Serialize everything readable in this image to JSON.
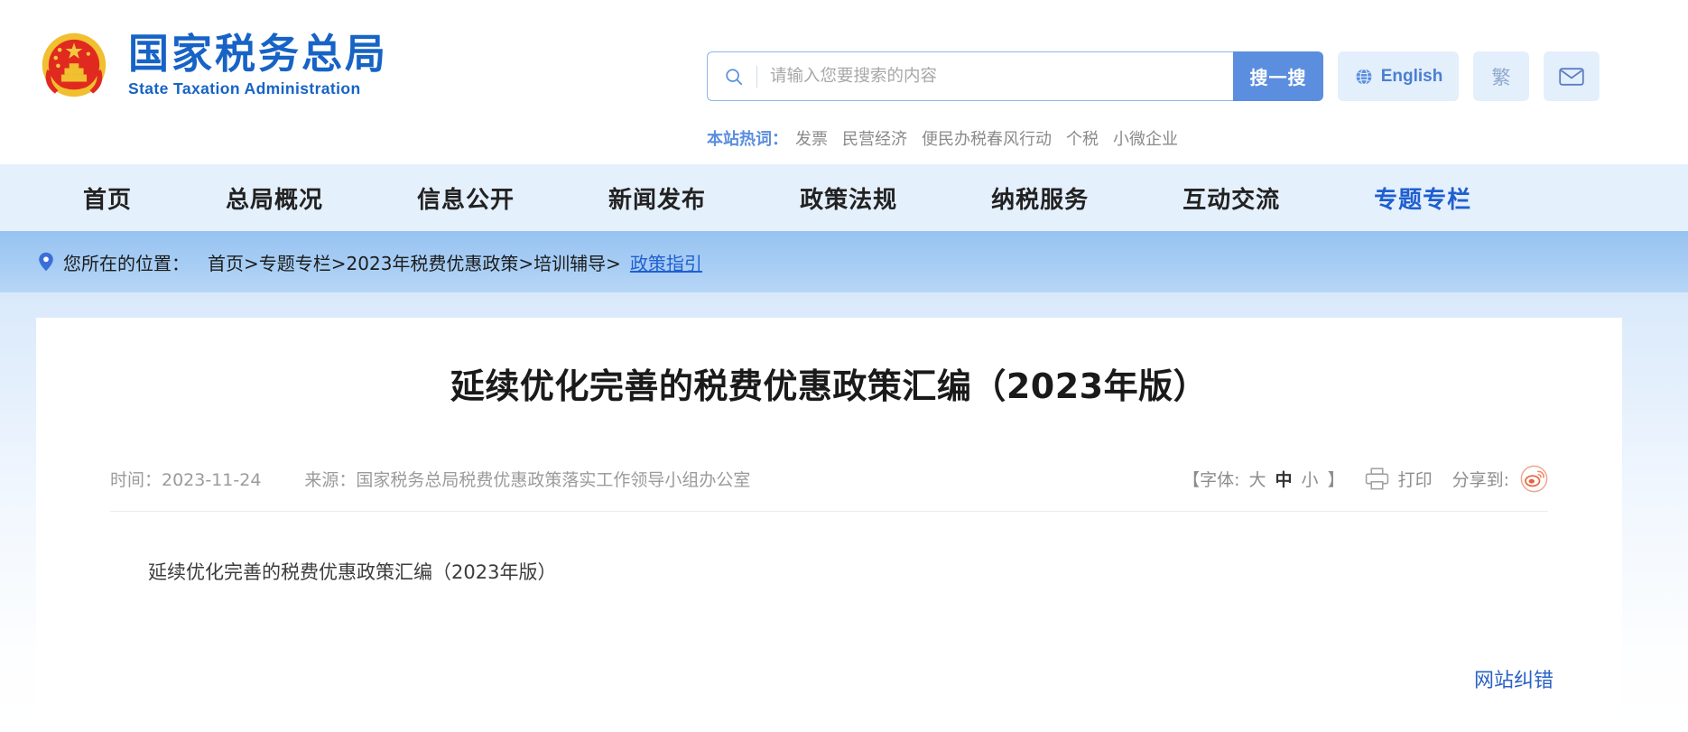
{
  "site": {
    "logo_cn": "国家税务总局",
    "logo_en": "State Taxation Administration",
    "emblem_icon": "national-emblem-icon"
  },
  "search": {
    "icon": "search-icon",
    "placeholder": "请输入您要搜索的内容",
    "value": "",
    "button_label": "搜一搜",
    "button_color": "#5b8ede"
  },
  "header_actions": {
    "english_label": "English",
    "english_icon": "globe-icon",
    "traditional_label": "繁",
    "mail_icon": "mail-icon"
  },
  "hotwords": {
    "label": "本站热词：",
    "items": [
      "发票",
      "民营经济",
      "便民办税春风行动",
      "个税",
      "小微企业"
    ]
  },
  "nav": {
    "items": [
      {
        "label": "首页",
        "active": false
      },
      {
        "label": "总局概况",
        "active": false
      },
      {
        "label": "信息公开",
        "active": false
      },
      {
        "label": "新闻发布",
        "active": false
      },
      {
        "label": "政策法规",
        "active": false
      },
      {
        "label": "纳税服务",
        "active": false
      },
      {
        "label": "互动交流",
        "active": false
      },
      {
        "label": "专题专栏",
        "active": true
      }
    ],
    "active_color": "#1f5fd0"
  },
  "breadcrumb": {
    "pin_icon": "location-pin-icon",
    "label": "您所在的位置：",
    "path_prefix": "首页>专题专栏>2023年税费优惠政策>培训辅导>",
    "current": "政策指引"
  },
  "article": {
    "title": "延续优化完善的税费优惠政策汇编（2023年版）",
    "time_label": "时间：2023-11-24",
    "source_label": "来源：国家税务总局税费优惠政策落实工作领导小组办公室",
    "body": "延续优化完善的税费优惠政策汇编（2023年版）"
  },
  "tools": {
    "fontsize_open": "【字体:",
    "fontsize_large": "大",
    "fontsize_medium": "中",
    "fontsize_small": "小",
    "fontsize_close": "】",
    "fontsize_selected": "中",
    "printer_icon": "printer-icon",
    "print_label": "打印",
    "share_label": "分享到:",
    "weibo_icon": "weibo-icon",
    "weibo_color": "#e8603c"
  },
  "footer": {
    "correction_label": "网站纠错"
  }
}
